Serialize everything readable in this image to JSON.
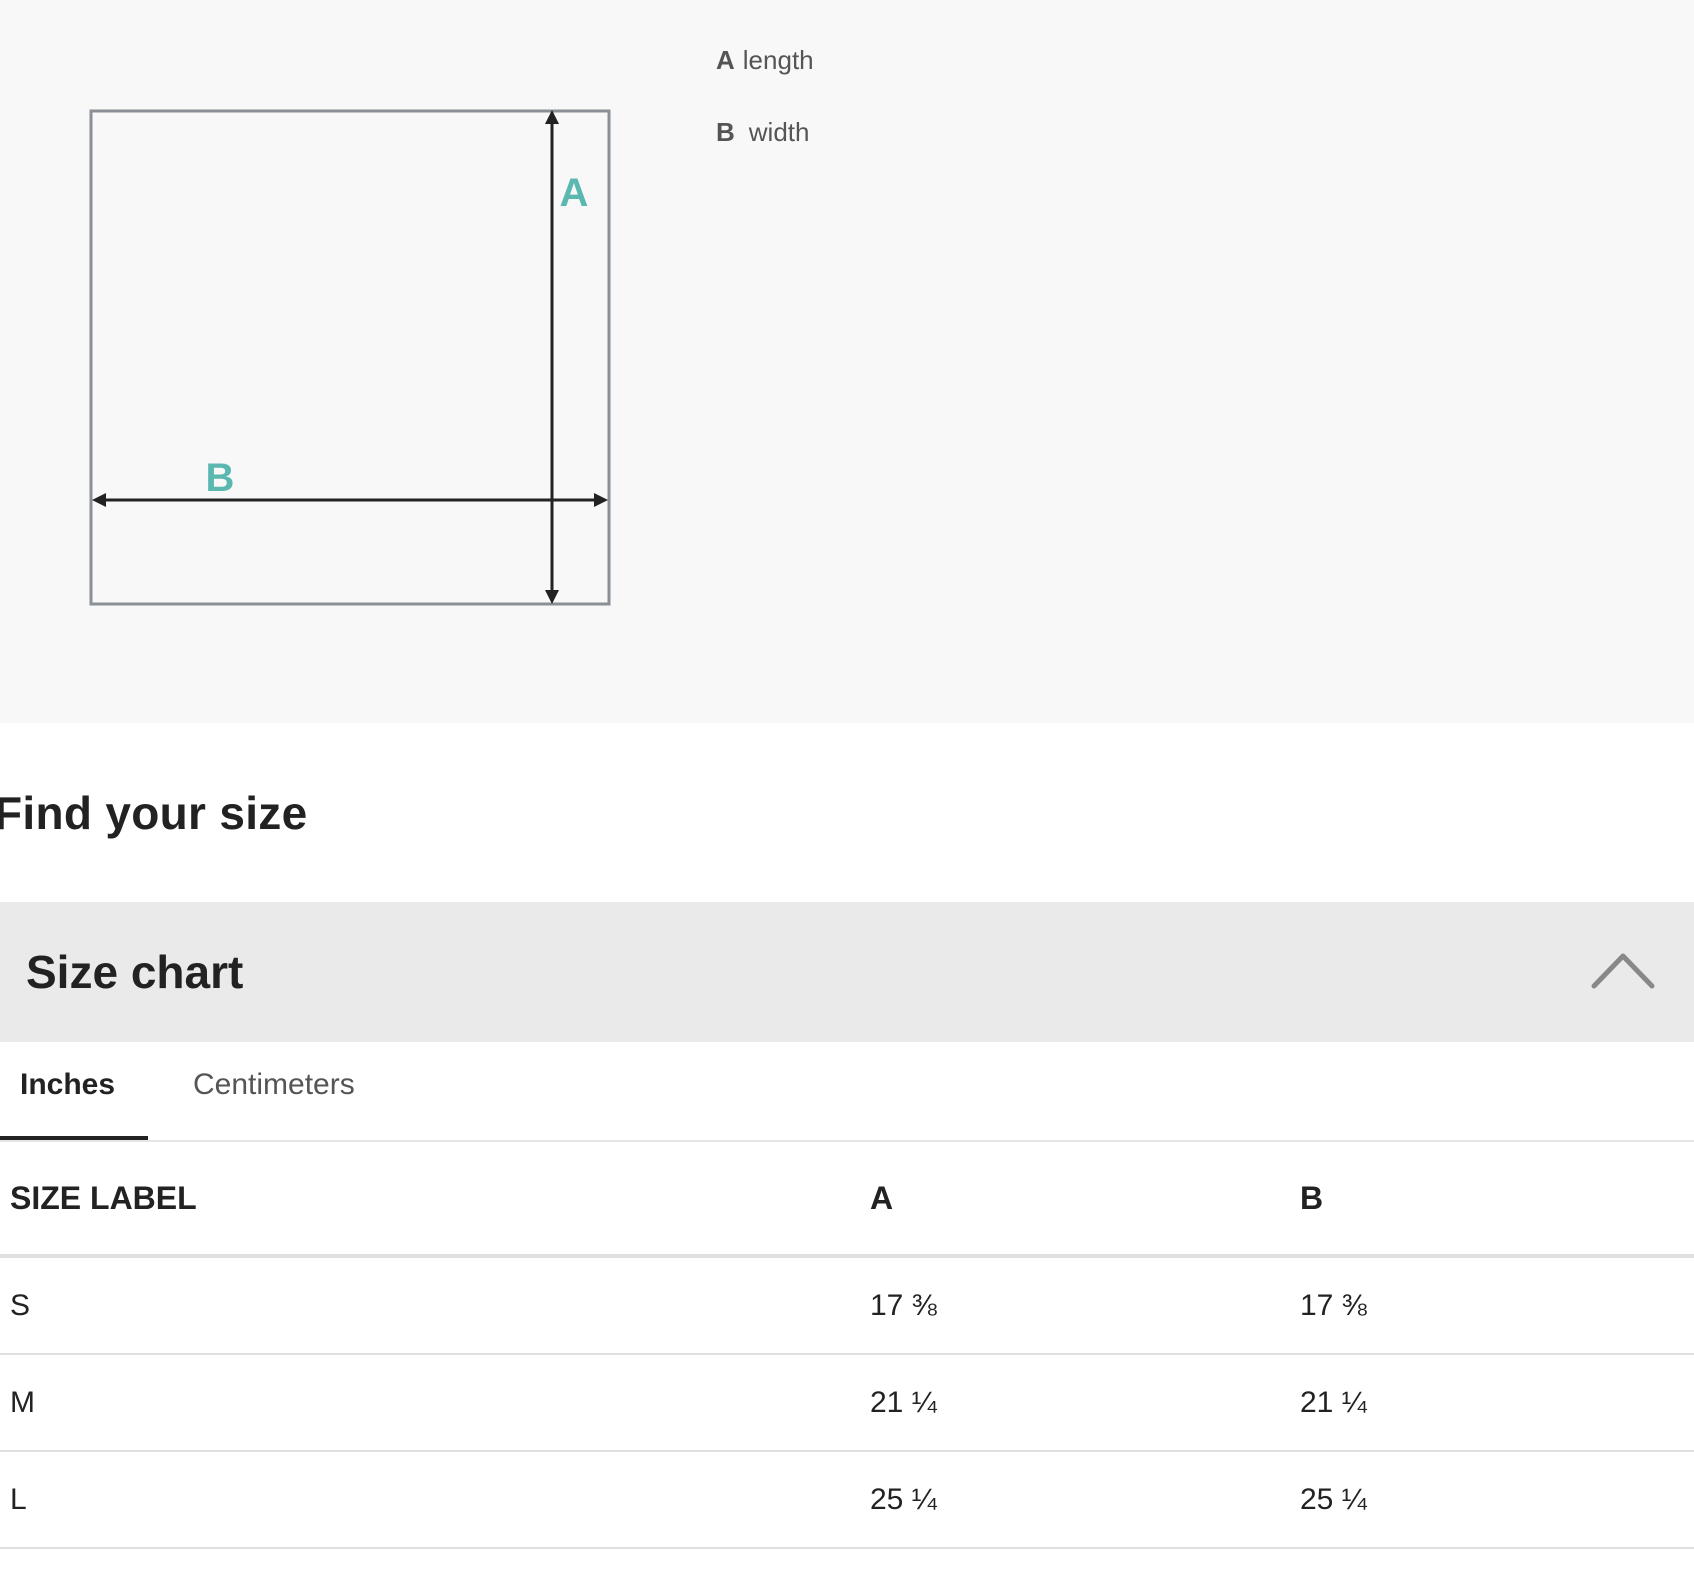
{
  "diagram": {
    "labels": {
      "a": "A",
      "b": "B"
    },
    "accent_color": "#5bb8b0",
    "legend": [
      {
        "key": "A",
        "text": "length"
      },
      {
        "key": "B",
        "text": "width"
      }
    ]
  },
  "find_size": {
    "title": "Find your size"
  },
  "size_chart": {
    "title": "Size chart",
    "expanded": true,
    "toggle_icon": "chevron-up-icon",
    "tabs": [
      {
        "label": "Inches",
        "active": true
      },
      {
        "label": "Centimeters",
        "active": false
      }
    ],
    "columns": [
      "SIZE LABEL",
      "A",
      "B"
    ],
    "rows": [
      {
        "size": "S",
        "a": "17 ⅜",
        "b": "17 ⅜"
      },
      {
        "size": "M",
        "a": "21 ¼",
        "b": "21 ¼"
      },
      {
        "size": "L",
        "a": "25 ¼",
        "b": "25 ¼"
      }
    ]
  }
}
